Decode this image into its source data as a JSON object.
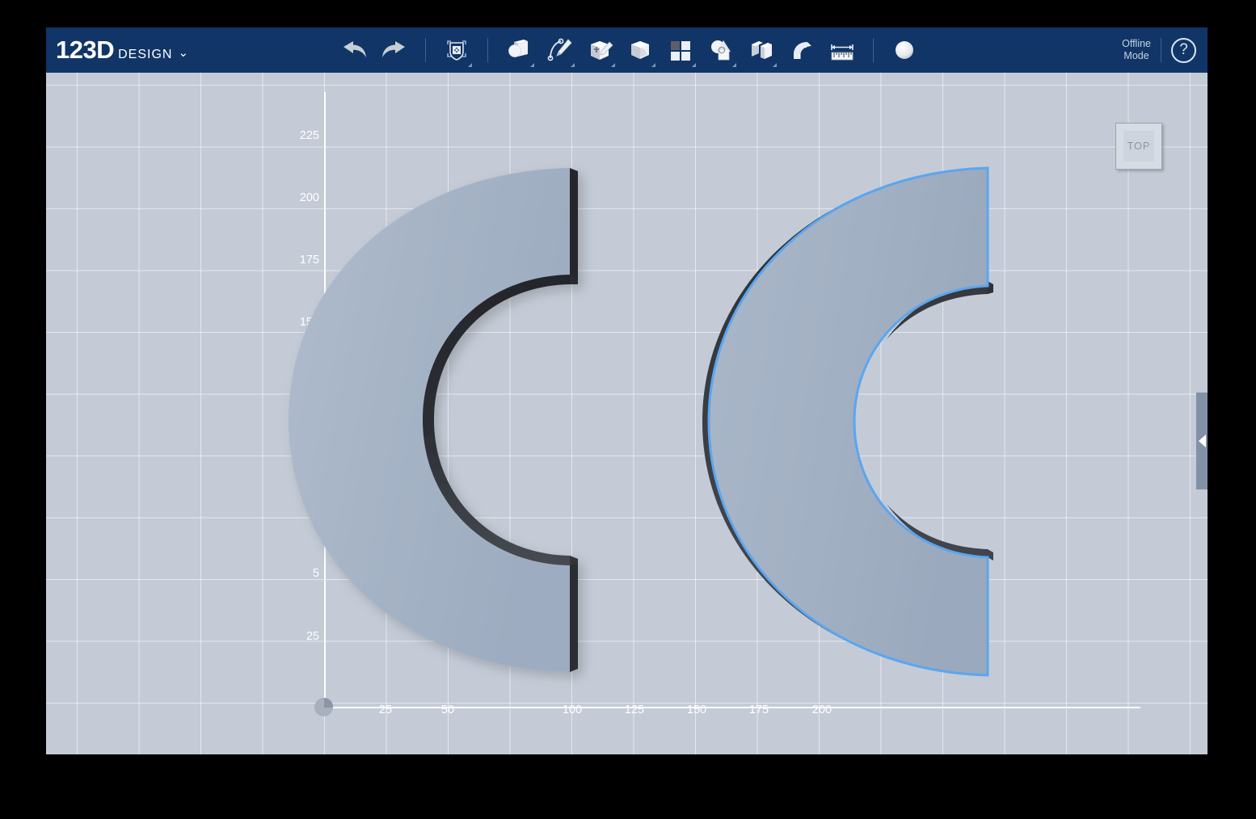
{
  "app": {
    "brand_primary": "123D",
    "brand_secondary": "DESIGN",
    "brand_caret": "⌄",
    "header_color": "#113567",
    "canvas_bg": "#c4cbd6"
  },
  "toolbar": {
    "items": [
      {
        "name": "undo-button",
        "label": "Undo",
        "icon": "undo-arrow-icon",
        "has_menu": false
      },
      {
        "name": "redo-button",
        "label": "Redo",
        "icon": "redo-arrow-icon",
        "has_menu": false
      },
      {
        "name": "transform-tool",
        "label": "Transform",
        "icon": "move-gizmo-icon",
        "has_menu": true
      },
      {
        "name": "primitives-tool",
        "label": "Primitives",
        "icon": "sphere-cube-icon",
        "has_menu": true
      },
      {
        "name": "sketch-tool",
        "label": "Sketch",
        "icon": "pencil-spline-icon",
        "has_menu": true
      },
      {
        "name": "construct-tool",
        "label": "Construct",
        "icon": "cube-pencil-icon",
        "has_menu": true
      },
      {
        "name": "modify-tool",
        "label": "Modify",
        "icon": "cube-fillet-icon",
        "has_menu": true
      },
      {
        "name": "pattern-tool",
        "label": "Pattern",
        "icon": "grid-squares-icon",
        "has_menu": true
      },
      {
        "name": "grouping-tool",
        "label": "Grouping",
        "icon": "shapes-overlap-icon",
        "has_menu": true
      },
      {
        "name": "combine-tool",
        "label": "Combine",
        "icon": "cube-split-icon",
        "has_menu": true
      },
      {
        "name": "snap-tool",
        "label": "Snap",
        "icon": "magnet-icon",
        "has_menu": false
      },
      {
        "name": "measure-tool",
        "label": "Measure",
        "icon": "ruler-icon",
        "has_menu": false
      },
      {
        "name": "material-tool",
        "label": "Material",
        "icon": "sphere-icon",
        "has_menu": false
      }
    ]
  },
  "header_right": {
    "offline_line1": "Offline",
    "offline_line2": "Mode",
    "help_label": "?"
  },
  "view_cube": {
    "face_label": "TOP"
  },
  "chart_data": {
    "type": "scatter",
    "title": "",
    "xlabel": "",
    "ylabel": "",
    "grid": true,
    "x_ticks": [
      {
        "label": "25",
        "value": 25
      },
      {
        "label": "50",
        "value": 50
      },
      {
        "label": "100",
        "value": 100
      },
      {
        "label": "125",
        "value": 125
      },
      {
        "label": "150",
        "value": 150
      },
      {
        "label": "175",
        "value": 175
      },
      {
        "label": "200",
        "value": 200
      }
    ],
    "y_ticks": [
      {
        "label": "225",
        "value": 225
      },
      {
        "label": "200",
        "value": 200
      },
      {
        "label": "175",
        "value": 175
      },
      {
        "label": "150",
        "value": 150
      },
      {
        "label": "5",
        "value": 50
      },
      {
        "label": "25",
        "value": 25
      }
    ],
    "grid_step": 25,
    "objects": [
      {
        "name": "solid-left",
        "shape": "c-bracket",
        "selected": false
      },
      {
        "name": "solid-right",
        "shape": "c-bracket",
        "selected": true
      }
    ]
  },
  "side_panel": {
    "arrow_glyph": "◀"
  },
  "colors": {
    "selection_blue": "#5aa6f0",
    "face_light": "#c2cbd7",
    "face_shaded": "#9aa8ba",
    "extrude_dark": "#2e3034",
    "grid_line": "#ffffff"
  }
}
